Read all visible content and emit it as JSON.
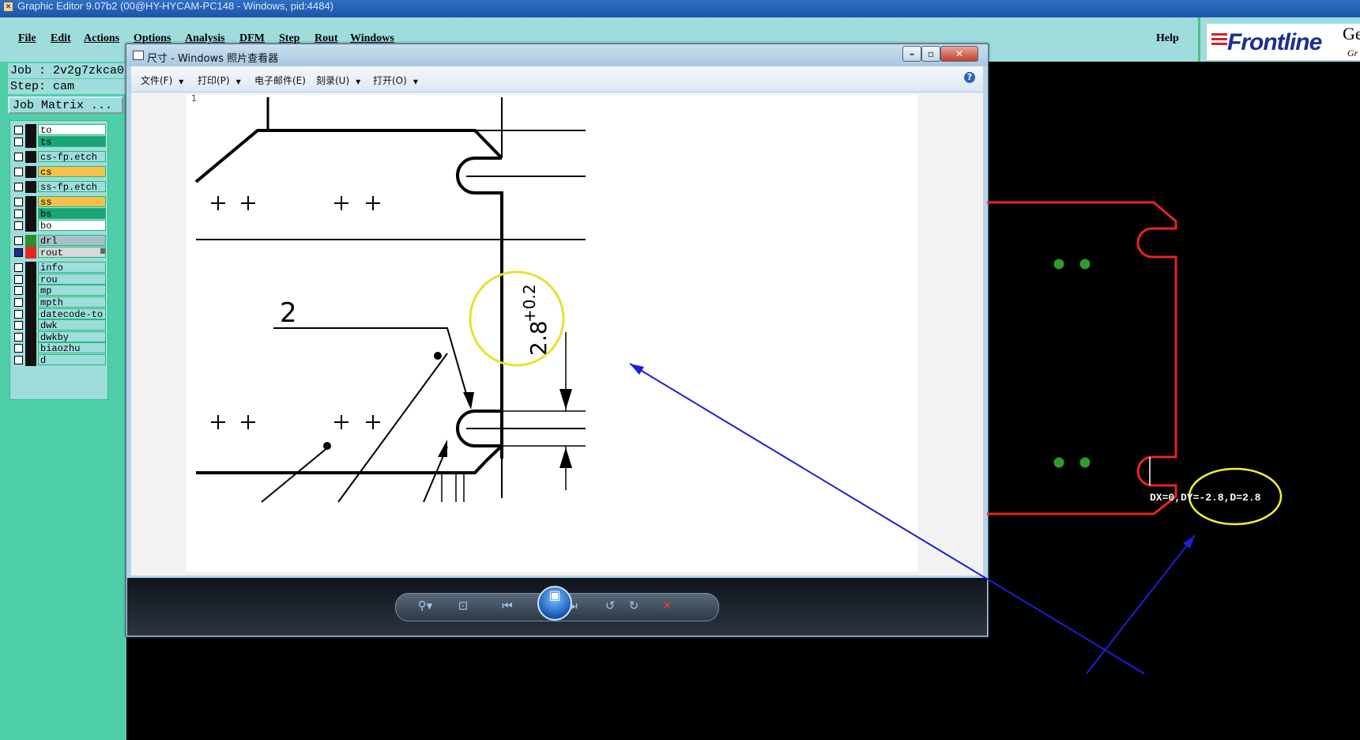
{
  "app": {
    "title": "Graphic Editor 9.07b2 (00@HY-HYCAM-PC148 - Windows, pid:4484)",
    "icon": "x-icon"
  },
  "menubar": {
    "items": [
      "File",
      "Edit",
      "Actions",
      "Options",
      "Analysis",
      "DFM",
      "Step",
      "Rout",
      "Windows"
    ],
    "help": "Help"
  },
  "logo": {
    "brand": "Frontline",
    "partial_text": "Ger",
    "partial_sub": "Gr"
  },
  "job": {
    "job_line": "Job : 2v2g7zkca0",
    "step_line": "Step: cam",
    "matrix_button": "Job Matrix ..."
  },
  "layers": [
    {
      "name": "to",
      "swatch": "#111111",
      "bg": "#ffffff",
      "checked": false
    },
    {
      "name": "ts",
      "swatch": "#111111",
      "bg": "#1aa37a",
      "checked": false
    },
    {
      "name": "cs-fp.etch",
      "swatch": "#111111",
      "bg": "#9fdcdc",
      "checked": false
    },
    {
      "name": "cs",
      "swatch": "#111111",
      "bg": "#f7c04a",
      "checked": false
    },
    {
      "name": "ss-fp.etch",
      "swatch": "#111111",
      "bg": "#9fdcdc",
      "checked": false
    },
    {
      "name": "ss",
      "swatch": "#111111",
      "bg": "#f7c04a",
      "checked": false
    },
    {
      "name": "bs",
      "swatch": "#111111",
      "bg": "#1aa37a",
      "checked": false
    },
    {
      "name": "bo",
      "swatch": "#111111",
      "bg": "#ffffff",
      "checked": false
    },
    {
      "name": "drl",
      "swatch": "#2e8b2e",
      "bg": "#a7bfc6",
      "checked": false
    },
    {
      "name": "rout",
      "swatch": "#e8251f",
      "bg": "#d8d8d8",
      "checked": true
    },
    {
      "name": "info",
      "swatch": "#111111",
      "bg": "#9fdcdc",
      "checked": false
    },
    {
      "name": "rou",
      "swatch": "#111111",
      "bg": "#9fdcdc",
      "checked": false
    },
    {
      "name": "mp",
      "swatch": "#111111",
      "bg": "#9fdcdc",
      "checked": false
    },
    {
      "name": "mpth",
      "swatch": "#111111",
      "bg": "#9fdcdc",
      "checked": false
    },
    {
      "name": "datecode-to",
      "swatch": "#111111",
      "bg": "#9fdcdc",
      "checked": false
    },
    {
      "name": "dwk",
      "swatch": "#111111",
      "bg": "#9fdcdc",
      "checked": false
    },
    {
      "name": "dwkby",
      "swatch": "#111111",
      "bg": "#9fdcdc",
      "checked": false
    },
    {
      "name": "biaozhu",
      "swatch": "#111111",
      "bg": "#9fdcdc",
      "checked": false
    },
    {
      "name": "d",
      "swatch": "#111111",
      "bg": "#9fdcdc",
      "checked": false
    }
  ],
  "viewer": {
    "title": "尺寸 - Windows 照片查看器",
    "menu": [
      "文件(F)",
      "打印(P)",
      "电子邮件(E)",
      "刻录(U)",
      "打开(O)"
    ],
    "drawing_dimension_label": "2",
    "drawing_tolerance_main": "2.8",
    "drawing_tolerance_sup": "+0.2",
    "corner_number": "1"
  },
  "cad": {
    "measure_text": "DX=0,DY=-2.8,D=2.8"
  },
  "colors": {
    "rout": "#e8251f",
    "pad": "#2e9a2e",
    "annotation_circle": "#f2ee3a",
    "arrow": "#1f1fd6"
  }
}
